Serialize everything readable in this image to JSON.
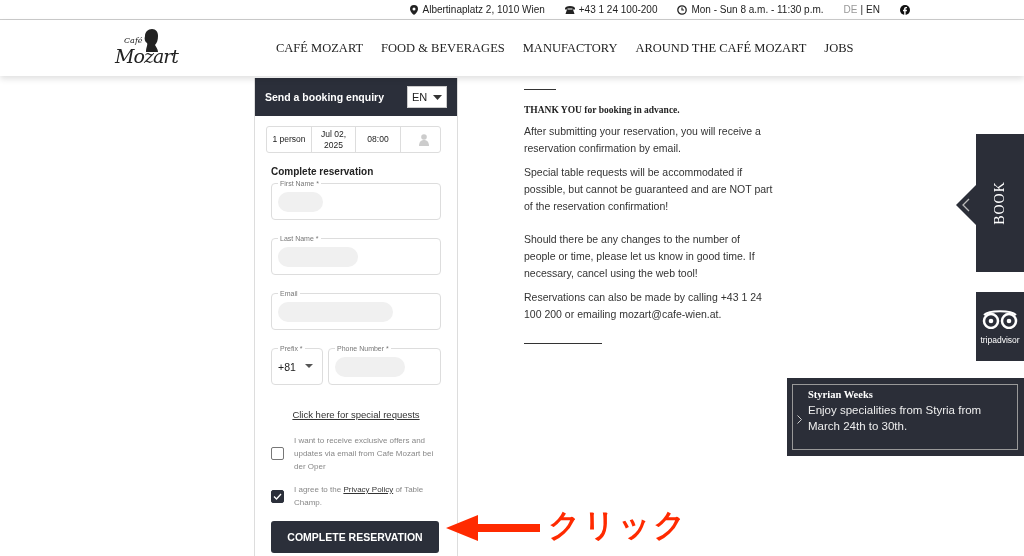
{
  "top_bar": {
    "address": "Albertinaplatz 2, 1010 Wien",
    "phone": "+43 1 24 100-200",
    "hours": "Mon - Sun 8 a.m. - 11:30 p.m.",
    "languages": [
      {
        "label": "DE",
        "selected": false
      },
      {
        "label": "EN",
        "selected": true
      }
    ],
    "separator": "|"
  },
  "logo": {
    "top": "Café",
    "main": "Mozart"
  },
  "nav": [
    "CAFÉ MOZART",
    "FOOD & BEVERAGES",
    "MANUFACTORY",
    "AROUND THE CAFÉ MOZART",
    "JOBS"
  ],
  "form": {
    "title": "Send a booking enquiry",
    "language": "EN",
    "summary": [
      "1 person",
      "Jul 02, 2025",
      "08:00"
    ],
    "heading": "Complete reservation",
    "fields": [
      {
        "label": "First Name *",
        "kind": "text"
      },
      {
        "label": "Last Name *",
        "kind": "text"
      },
      {
        "label": "Email",
        "kind": "text"
      }
    ],
    "prefix": {
      "label": "Prefix *",
      "value": "+81"
    },
    "phone": {
      "label": "Phone Number *"
    },
    "special_link": "Click here for special requests",
    "checkboxes": [
      {
        "text": "I want to receive exclusive offers and updates via email from Cafe Mozart bei der Oper",
        "checked": false
      },
      {
        "text": "I agree to the **Privacy Policy** of Table Champ.",
        "checked": true
      }
    ],
    "submit": "COMPLETE RESERVATION"
  },
  "info": {
    "heading": "THANK YOU for booking in advance.",
    "paragraphs": [
      "After submitting your reservation, you will receive a reservation confirmation by email.",
      "Special table requests will be accommodated if possible, but cannot be guaranteed and are NOT part of the reservation confirmation!",
      "Should there be any changes to the number of people or time, please let us know in good time. If necessary, cancel using the web tool!",
      "Reservations can also be made by calling +43 1 24 100 200 or emailing mozart@cafe-wien.at."
    ]
  },
  "book_tab": "BOOK",
  "tripadvisor": "tripadvisor",
  "promo": {
    "title": "Styrian Weeks",
    "text": "Enjoy specialities from Styria from March 24th to 30th."
  },
  "annotation": "クリック"
}
